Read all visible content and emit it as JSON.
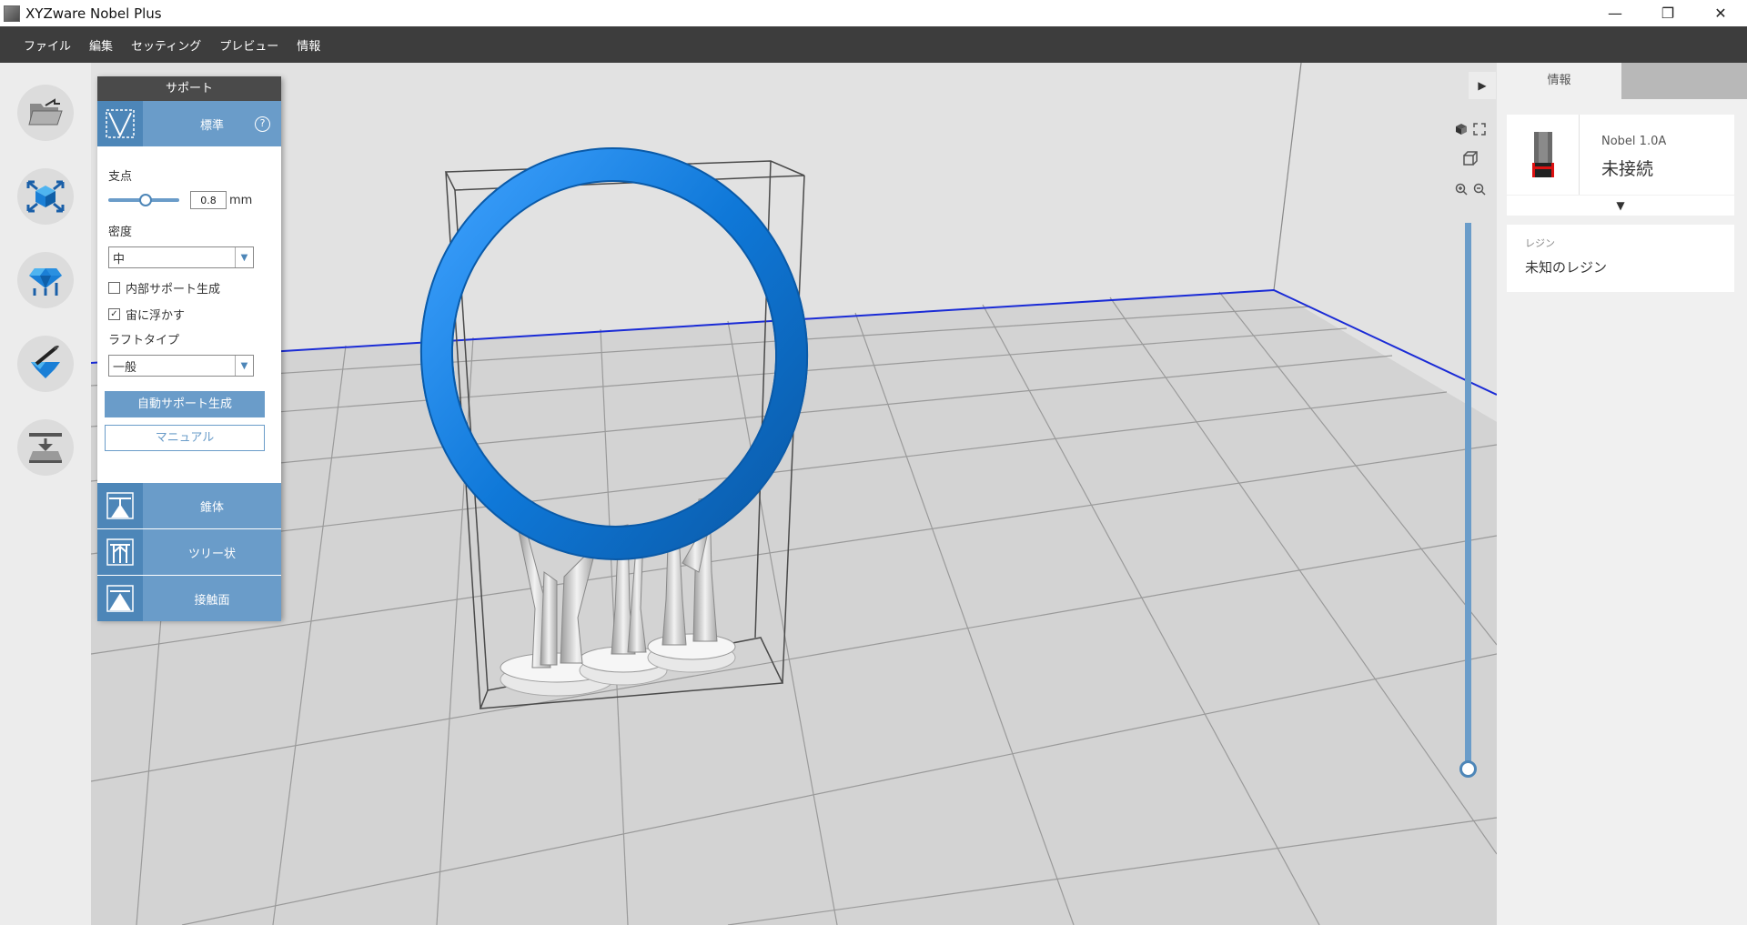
{
  "window": {
    "title": "XYZware Nobel Plus",
    "minimize_glyph": "—",
    "maximize_glyph": "❐",
    "close_glyph": "✕"
  },
  "menu": {
    "items": [
      "ファイル",
      "編集",
      "セッティング",
      "プレビュー",
      "情報"
    ]
  },
  "left_tools": [
    {
      "name": "open-file-icon"
    },
    {
      "name": "transform-icon"
    },
    {
      "name": "gem-icon"
    },
    {
      "name": "edit-support-icon"
    },
    {
      "name": "slice-icon"
    }
  ],
  "support_panel": {
    "header": "サポート",
    "mode_label": "標準",
    "help_glyph": "?",
    "point_label": "支点",
    "point_value": "0.8",
    "point_unit": "mm",
    "density_label": "密度",
    "density_value": "中",
    "internal_support_label": "内部サポート生成",
    "internal_support_checked": false,
    "float_label": "宙に浮かす",
    "float_checked": true,
    "raft_label": "ラフトタイプ",
    "raft_value": "一般",
    "auto_button": "自動サポート生成",
    "manual_button": "マニュアル",
    "types": [
      "錐体",
      "ツリー状",
      "接触面"
    ]
  },
  "viewport": {
    "collapse_glyph": "▶",
    "accent": "#1a7fd6",
    "boundary_color": "#1a2bd6"
  },
  "right_panel": {
    "tab_label": "情報",
    "printer_model": "Nobel 1.0A",
    "printer_status": "未接続",
    "expand_glyph": "▼",
    "resin_label": "レジン",
    "resin_value": "未知のレジン"
  }
}
